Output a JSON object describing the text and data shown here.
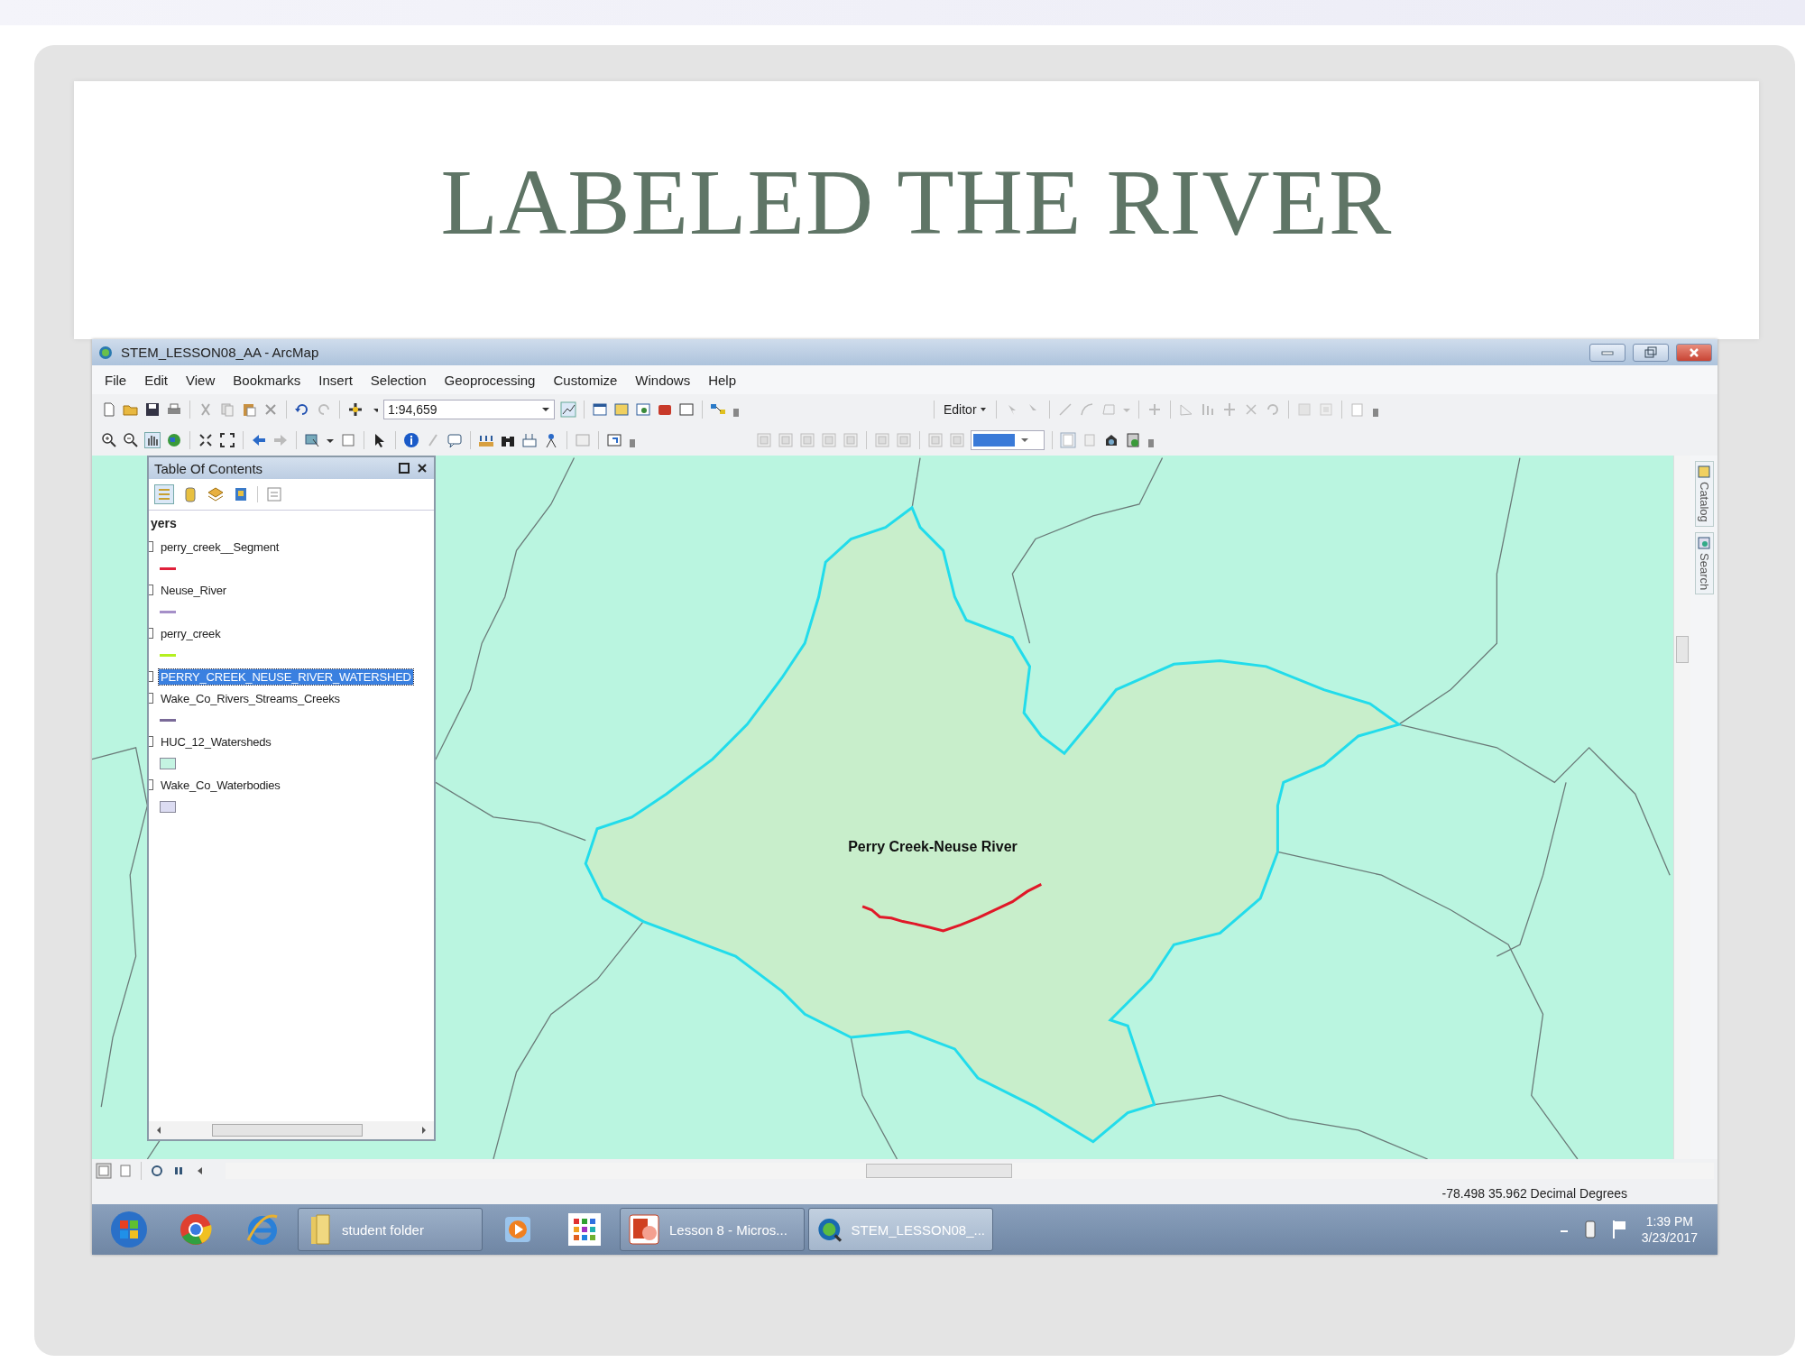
{
  "slide": {
    "title": "LABELED THE RIVER"
  },
  "window": {
    "title": "STEM_LESSON08_AA - ArcMap"
  },
  "menu": [
    "File",
    "Edit",
    "View",
    "Bookmarks",
    "Insert",
    "Selection",
    "Geoprocessing",
    "Customize",
    "Windows",
    "Help"
  ],
  "toolbar": {
    "scale": "1:94,659",
    "editor": "Editor"
  },
  "toc": {
    "title": "Table Of Contents",
    "group": "yers",
    "layers": [
      {
        "name": "perry_creek__Segment",
        "selected": false,
        "symbol": {
          "kind": "line",
          "color": "#e0203a"
        }
      },
      {
        "name": "Neuse_River",
        "selected": false,
        "symbol": {
          "kind": "line",
          "color": "#a58fc8"
        }
      },
      {
        "name": "perry_creek",
        "selected": false,
        "symbol": {
          "kind": "line",
          "color": "#b4f020"
        }
      },
      {
        "name": "PERRY_CREEK_NEUSE_RIVER_WATERSHED",
        "selected": true
      },
      {
        "name": "Wake_Co_Rivers_Streams_Creeks",
        "selected": false,
        "symbol": {
          "kind": "line",
          "color": "#7a6a98"
        }
      },
      {
        "name": "HUC_12_Watersheds",
        "selected": false,
        "symbol": {
          "kind": "fill",
          "color": "#c4f4e2"
        }
      },
      {
        "name": "Wake_Co_Waterbodies",
        "selected": false,
        "symbol": {
          "kind": "fill",
          "color": "#dcdcf2"
        }
      }
    ]
  },
  "map": {
    "label": "Perry Creek-Neuse River"
  },
  "side_tabs": [
    "Catalog",
    "Search"
  ],
  "status": {
    "coordinates": "-78.498  35.962 Decimal Degrees"
  },
  "taskbar": {
    "items": [
      {
        "kind": "folder",
        "label": "student folder",
        "selected": false
      },
      {
        "kind": "media"
      },
      {
        "kind": "apps"
      },
      {
        "kind": "powerpoint",
        "label": "Lesson 8 - Micros...",
        "selected": false
      },
      {
        "kind": "arcmap",
        "label": "STEM_LESSON08_...",
        "selected": true
      }
    ],
    "time": "1:39 PM",
    "date": "3/23/2017"
  }
}
